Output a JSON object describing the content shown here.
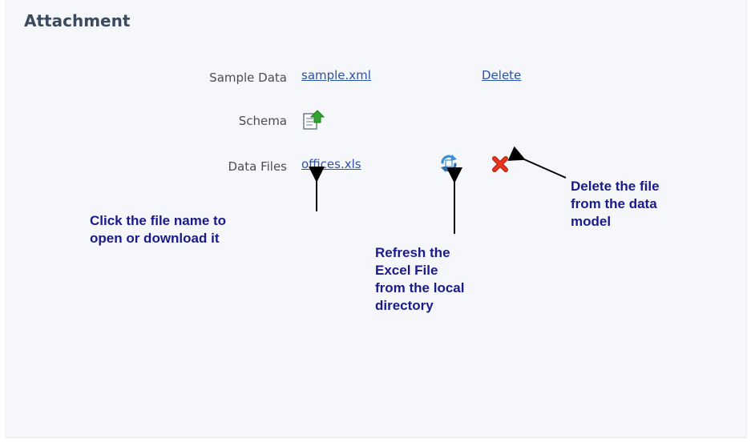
{
  "section": {
    "title": "Attachment"
  },
  "rows": {
    "sample_data": {
      "label": "Sample Data",
      "file_link": "sample.xml",
      "delete_link": "Delete"
    },
    "schema": {
      "label": "Schema",
      "icon": "upload-schema-icon"
    },
    "data_files": {
      "label": "Data Files",
      "file_link": "offices.xls",
      "refresh_icon": "refresh-icon",
      "delete_icon": "delete-x-icon"
    }
  },
  "annotations": {
    "file_name": "Click the file name to\nopen or download it",
    "refresh": "Refresh the\nExcel File\nfrom the local\ndirectory",
    "delete": "Delete the file\nfrom the data\nmodel"
  },
  "colors": {
    "label": "#4d4d4d",
    "link": "#2a52a8",
    "annotation": "#1a1a8c",
    "delete_x": "#e8341c",
    "refresh": "#3d8fd6",
    "schema_arrow": "#2fa52f"
  }
}
